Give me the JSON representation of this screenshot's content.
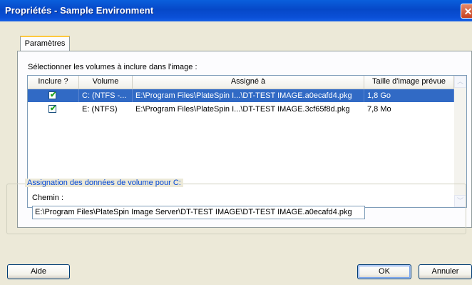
{
  "window": {
    "title": "Propriétés - Sample Environment",
    "close_glyph": "✕"
  },
  "tabs": [
    {
      "label": "Paramètres",
      "active": true
    }
  ],
  "volumes_section": {
    "label": "Sélectionner les volumes à inclure dans l'image :",
    "columns": [
      "Inclure ?",
      "Volume",
      "Assigné à",
      "Taille d'image prévue"
    ],
    "rows": [
      {
        "include": true,
        "volume": "C: (NTFS -...",
        "assigned_to": "E:\\Program Files\\PlateSpin I...\\DT-TEST IMAGE.a0ecafd4.pkg",
        "size": "1,8 Go",
        "selected": true
      },
      {
        "include": true,
        "volume": "E: (NTFS)",
        "assigned_to": "E:\\Program Files\\PlateSpin I...\\DT-TEST IMAGE.3cf65f8d.pkg",
        "size": "7,8 Mo",
        "selected": false
      }
    ],
    "scrollbar": {
      "up_glyph": "︿",
      "down_glyph": "﹀"
    }
  },
  "assignment_group": {
    "legend": "Assignation des données de volume pour C:",
    "path_label": "Chemin :",
    "path_value": "E:\\Program Files\\PlateSpin Image Server\\DT-TEST IMAGE\\DT-TEST IMAGE.a0ecafd4.pkg"
  },
  "buttons": {
    "help": "Aide",
    "ok": "OK",
    "cancel": "Annuler"
  },
  "checkmark_glyph": "✔",
  "colors": {
    "titlebar": "#0a5fdc",
    "selection": "#316ac5",
    "group_legend": "#0046d5",
    "tab_highlight": "#ffc83c"
  }
}
